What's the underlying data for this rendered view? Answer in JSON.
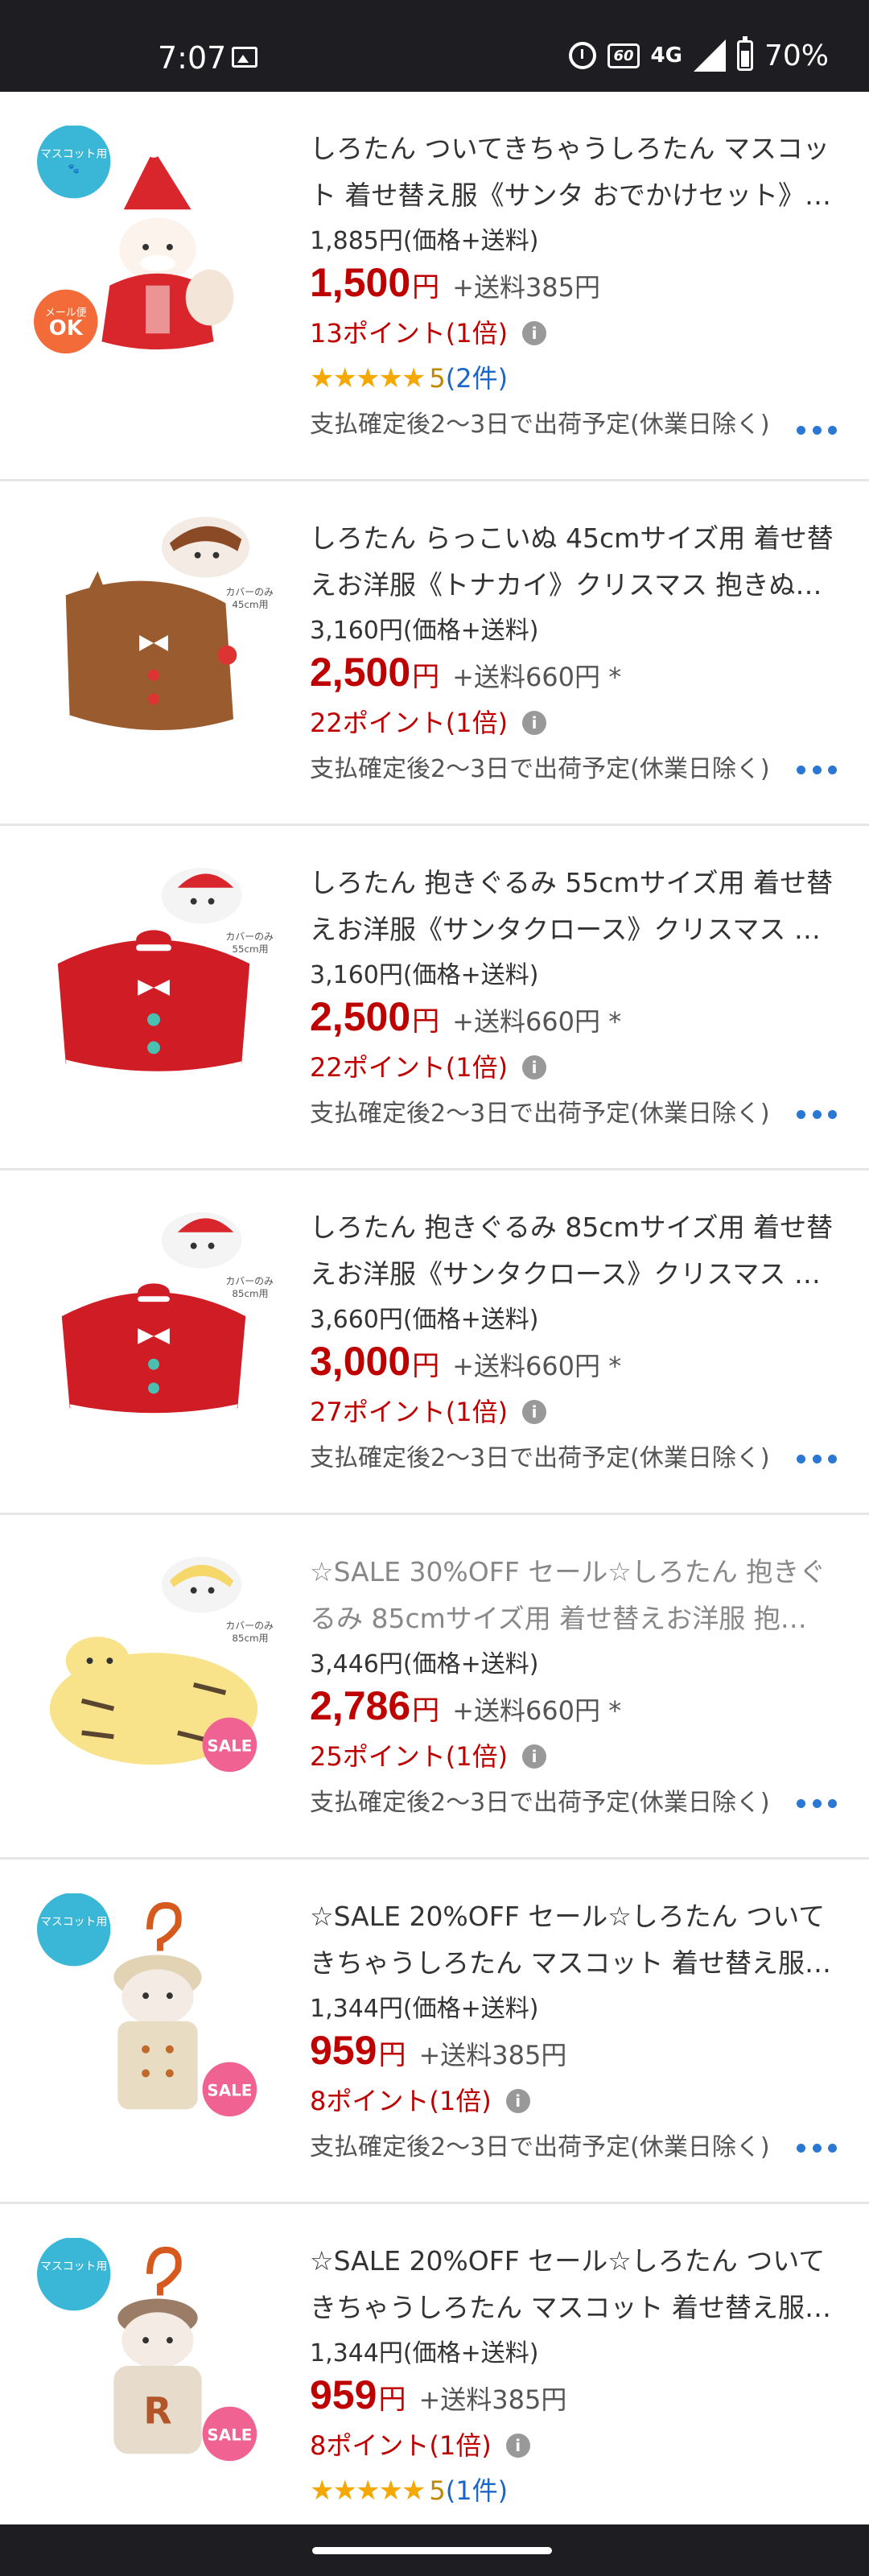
{
  "status_bar": {
    "time": "7:07",
    "hd_label": "60",
    "network": "4G",
    "battery": "70%"
  },
  "items": [
    {
      "title": "しろたん ついてきちゃうしろたん マスコット 着せ替え服《サンタ おでかけセット》つ…",
      "ref_price": "1,885円(価格+送料)",
      "price": "1,500",
      "yen": "円",
      "shipping": "+送料385円",
      "points": "13ポイント(1倍)",
      "stars": "★★★★★",
      "score": "5",
      "count": "(2件)",
      "ship_note": "支払確定後2〜3日で出荷予定(休業日除く)",
      "badge": "メール便OK",
      "badge_top": "マスコット用"
    },
    {
      "title": "しろたん らっこいぬ 45cmサイズ用 着せ替えお洋服《トナカイ》クリスマス 抱きぬ…",
      "ref_price": "3,160円(価格+送料)",
      "price": "2,500",
      "yen": "円",
      "shipping": "+送料660円 *",
      "points": "22ポイント(1倍)",
      "ship_note": "支払確定後2〜3日で出荷予定(休業日除く)"
    },
    {
      "title": "しろたん 抱きぐるみ 55cmサイズ用 着せ替えお洋服《サンタクロース》クリスマス …",
      "ref_price": "3,160円(価格+送料)",
      "price": "2,500",
      "yen": "円",
      "shipping": "+送料660円 *",
      "points": "22ポイント(1倍)",
      "ship_note": "支払確定後2〜3日で出荷予定(休業日除く)"
    },
    {
      "title": "しろたん 抱きぐるみ 85cmサイズ用 着せ替えお洋服《サンタクロース》クリスマス …",
      "ref_price": "3,660円(価格+送料)",
      "price": "3,000",
      "yen": "円",
      "shipping": "+送料660円 *",
      "points": "27ポイント(1倍)",
      "ship_note": "支払確定後2〜3日で出荷予定(休業日除く)"
    },
    {
      "title": "☆SALE 30%OFF セール☆しろたん 抱きぐるみ 85cmサイズ用 着せ替えお洋服 抱…",
      "ref_price": "3,446円(価格+送料)",
      "price": "2,786",
      "yen": "円",
      "shipping": "+送料660円 *",
      "points": "25ポイント(1倍)",
      "ship_note": "支払確定後2〜3日で出荷予定(休業日除く)",
      "badge": "SALE"
    },
    {
      "title": "☆SALE 20%OFF セール☆しろたん ついてきちゃうしろたん マスコット 着せ替え服 …",
      "ref_price": "1,344円(価格+送料)",
      "price": "959",
      "yen": "円",
      "shipping": "+送料385円",
      "points": "8ポイント(1倍)",
      "ship_note": "支払確定後2〜3日で出荷予定(休業日除く)",
      "badge": "SALE",
      "badge_top": "マスコット用"
    },
    {
      "title": "☆SALE 20%OFF セール☆しろたん ついてきちゃうしろたん マスコット 着せ替え服 …",
      "ref_price": "1,344円(価格+送料)",
      "price": "959",
      "yen": "円",
      "shipping": "+送料385円",
      "points": "8ポイント(1倍)",
      "stars": "★★★★★",
      "score": "5",
      "count": "(1件)",
      "badge": "SALE",
      "badge_top": "マスコット用"
    }
  ],
  "info_icon_glyph": "i",
  "colors": {
    "price_red": "#bf0000",
    "link_blue": "#1a66c9",
    "star_gold": "#f5a800",
    "sale_pink": "#f06292",
    "mail_orange": "#f26b38"
  }
}
